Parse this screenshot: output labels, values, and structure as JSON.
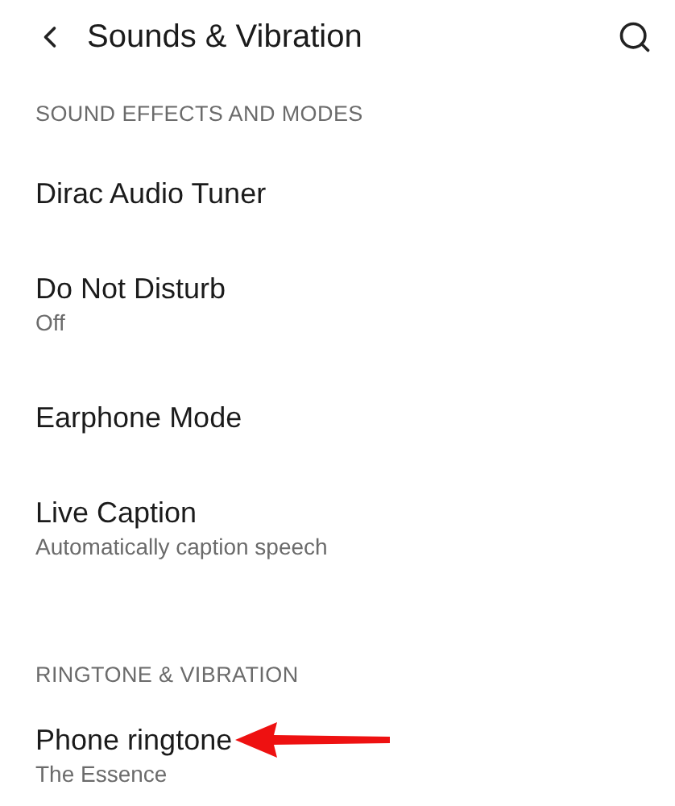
{
  "header": {
    "title": "Sounds & Vibration"
  },
  "sections": [
    {
      "heading": "SOUND EFFECTS AND MODES",
      "items": [
        {
          "title": "Dirac Audio Tuner"
        },
        {
          "title": "Do Not Disturb",
          "subtitle": "Off"
        },
        {
          "title": "Earphone Mode"
        },
        {
          "title": "Live Caption",
          "subtitle": "Automatically caption speech"
        }
      ]
    },
    {
      "heading": "RINGTONE & VIBRATION",
      "items": [
        {
          "title": "Phone ringtone",
          "subtitle": "The Essence",
          "annotated": true
        }
      ]
    }
  ]
}
